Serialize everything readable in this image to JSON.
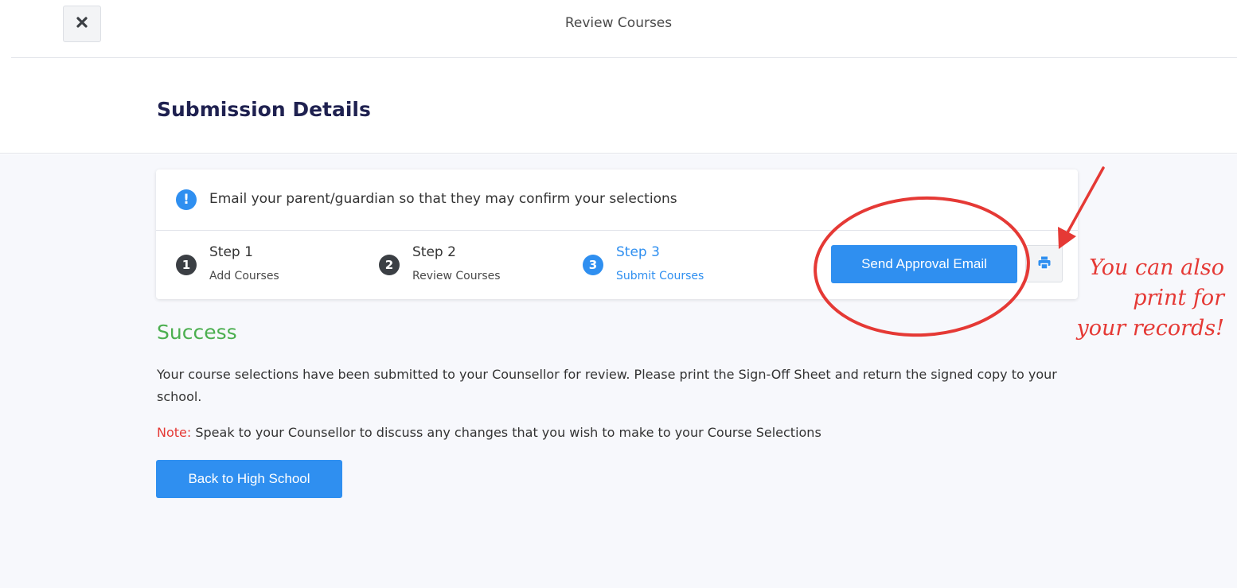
{
  "topbar": {
    "title": "Review Courses",
    "close_icon": "close-icon"
  },
  "header": {
    "title": "Submission Details"
  },
  "alert": {
    "icon": "info-icon",
    "icon_glyph": "!",
    "text": "Email your parent/guardian so that they may confirm your selections"
  },
  "steps": [
    {
      "number": "1",
      "title": "Step 1",
      "subtitle": "Add Courses",
      "active": false
    },
    {
      "number": "2",
      "title": "Step 2",
      "subtitle": "Review Courses",
      "active": false
    },
    {
      "number": "3",
      "title": "Step 3",
      "subtitle": "Submit Courses",
      "active": true
    }
  ],
  "actions": {
    "send_label": "Send Approval Email",
    "print_icon": "print-icon"
  },
  "success": {
    "title": "Success",
    "message": "Your course selections have been submitted to your Counsellor for review. Please print the Sign-Off Sheet and return the signed copy to your school.",
    "note_label": "Note:",
    "note_text": " Speak to your Counsellor to discuss any changes that you wish to make to your Course Selections",
    "back_label": "Back to High School"
  },
  "annotation": {
    "lines": [
      "You can also",
      "print for",
      "your records!"
    ],
    "color": "#e53935"
  },
  "colors": {
    "primary": "#2f8ff0",
    "success": "#4caf50",
    "heading": "#1f2150",
    "note": "#e53935"
  }
}
